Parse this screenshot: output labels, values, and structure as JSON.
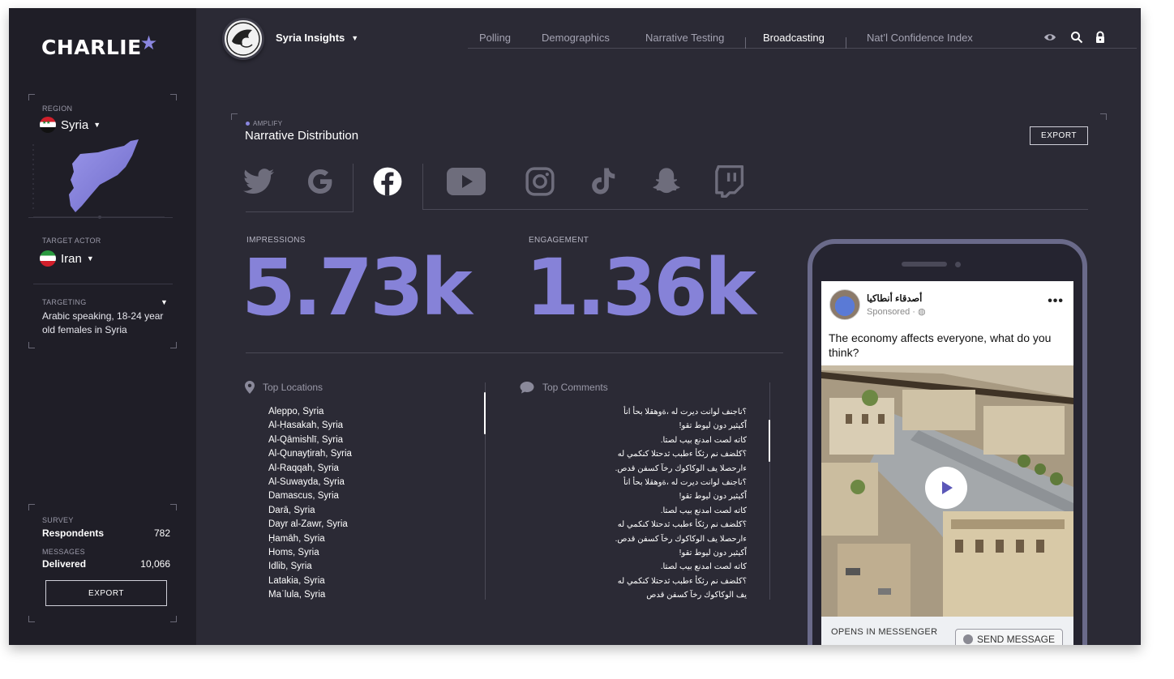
{
  "brand": {
    "logo_text": "CHARLIE",
    "logo_star": "★"
  },
  "sidebar": {
    "region": {
      "label": "REGION",
      "value": "Syria"
    },
    "target_actor": {
      "label": "TARGET ACTOR",
      "value": "Iran"
    },
    "targeting": {
      "label": "TARGETING",
      "text": "Arabic speaking, 18-24 year old females in Syria"
    },
    "survey": {
      "label": "SURVEY",
      "key": "Respondents",
      "value": "782"
    },
    "messages": {
      "label": "MESSAGES",
      "key": "Delivered",
      "value": "10,066"
    },
    "export_label": "EXPORT"
  },
  "header": {
    "workspace": "Syria Insights",
    "nav": [
      "Polling",
      "Demographics",
      "Narrative Testing",
      "Broadcasting",
      "Nat’l Confidence Index"
    ],
    "active_nav": "Broadcasting"
  },
  "main": {
    "eyebrow": "AMPLIFY",
    "title": "Narrative Distribution",
    "export_label": "EXPORT",
    "platforms": [
      "twitter",
      "google",
      "facebook",
      "youtube",
      "instagram",
      "tiktok",
      "snapchat",
      "twitch"
    ],
    "active_platform": "facebook",
    "impressions": {
      "label": "IMPRESSIONS",
      "value": "5.73k"
    },
    "engagement": {
      "label": "ENGAGEMENT",
      "value": "1.36k"
    },
    "locations": {
      "title": "Top Locations",
      "items": [
        "Aleppo, Syria",
        "Al-Ḥasakah, Syria",
        "Al-Qāmishlī, Syria",
        "Al-Qunayṭirah, Syria",
        "Al-Raqqah, Syria",
        "Al-Suwayda, Syria",
        "Damascus, Syria",
        "Darā, Syria",
        "Dayr al-Zawr, Syria",
        "Ḥamāh, Syria",
        "Homs, Syria",
        "Idlib, Syria",
        "Latakia, Syria",
        "Maʿlula, Syria"
      ]
    },
    "comments": {
      "title": "Top Comments",
      "items": [
        "؟ناجنف لوانت ديرت له ،ةوهقلا بحأ انأ",
        "!اًكيثير دون ليوط تقو",
        ".كاته لصت امدنع بيب لصتا",
        "؟كلضف نم رثكأ ءطبب ثدحتلا كنكمي له",
        ".ءارحصلا يف الوكاكوك رخآ كسفن قدص",
        "؟ناجنف لوانت ديرت له ،ةوهقلا بحأ انأ",
        "!اًكيثير دون ليوط تقو",
        ".كاته لصت امدنع بيب لصتا",
        "؟كلضف نم رثكأ ءطبب ثدحتلا كنكمي له",
        ".ءارحصلا يف الوكاكوك رخآ كسفن قدص",
        "!اًكيثير دون ليوط تقو",
        ".كاته لصت امدنع بيب لصتا",
        "؟كلضف نم رثكأ ءطبب ثدحتلا كنكمي له",
        "يف الوكاكوك رخآ كسفن قدص"
      ]
    }
  },
  "ad_preview": {
    "page_name": "أصدقاء أنطاكيا",
    "sponsored": "Sponsored ·",
    "post_text": "The economy affects everyone, what do you think?",
    "opens_in": "OPENS IN MESSENGER",
    "cta": "SEND MESSAGE"
  },
  "colors": {
    "accent": "#8682d8",
    "background": "#2b2a35",
    "sidebar": "#1f1e27"
  }
}
